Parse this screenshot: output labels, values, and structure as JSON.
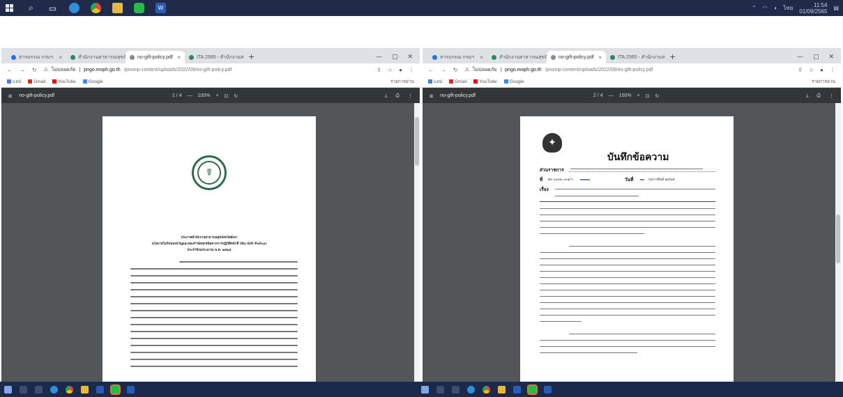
{
  "taskbar_top": {
    "icons": [
      "windows-logo-icon",
      "search-icon",
      "task-view-icon",
      "edge-icon",
      "chrome-icon",
      "file-explorer-icon",
      "line-app-icon",
      "word-icon"
    ],
    "clock_time": "11:54",
    "clock_date": "01/09/2565",
    "lang": "ไทย"
  },
  "left_window": {
    "tabs": [
      {
        "label": "สารบรรณ กรมฯ",
        "active": false
      },
      {
        "label": "สำนักงานสาธารณสุขจังหวัด",
        "active": false
      },
      {
        "label": "no-gift-policy.pdf",
        "active": true
      },
      {
        "label": "ITA 2565 - สำนักงานสาธารณสุข",
        "active": false
      }
    ],
    "url_host": "pngo.moph.go.th",
    "url_path": "/pnoinp-content/uploads/2022/09/no-gift-policy.pdf",
    "url_secure_label": "ไม่ปลอดภัย",
    "bookmarks": [
      "แอป",
      "Gmail",
      "YouTube",
      "Google"
    ],
    "bookmarks_right": "รายการอ่าน",
    "pdf_filename": "no-gift-policy.pdf",
    "pdf_page": "1 / 4",
    "pdf_zoom": "100%",
    "doc": {
      "heading": "ประกาศสำนักงานสาธารณสุขจังหวัดพังงา",
      "title": "นโยบายไม่รับของขวัญและของกำนัลทุกชนิดจากการปฏิบัติหน้าที่ (No Gift Policy)",
      "subtitle": "ประจำปีงบประมาณ พ.ศ. ๒๕๖๕"
    }
  },
  "right_window": {
    "tabs": [
      {
        "label": "สารบรรณ กรมฯ",
        "active": false
      },
      {
        "label": "สำนักงานสาธารณสุขจังหวัด",
        "active": false
      },
      {
        "label": "no-gift-policy.pdf",
        "active": true
      },
      {
        "label": "ITA 2565 - สำนักงานสาธารณสุข",
        "active": false
      }
    ],
    "url_host": "pngo.moph.go.th",
    "url_path": "/pnoinp-content/uploads/2022/09/no-gift-policy.pdf",
    "url_secure_label": "ไม่ปลอดภัย",
    "bookmarks": [
      "แอป",
      "Gmail",
      "YouTube",
      "Google"
    ],
    "bookmarks_right": "รายการอ่าน",
    "pdf_filename": "no-gift-policy.pdf",
    "pdf_page": "2 / 4",
    "pdf_zoom": "100%",
    "memo": {
      "title": "บันทึกข้อความ",
      "label_agency": "ส่วนราชการ",
      "label_number": "ที่",
      "label_date": "วันที่",
      "label_subject": "เรื่อง",
      "number_value": "พง ๐๐๓๓.๐๐๑/ว",
      "date_value": "กุมภาพันธ์ ๒๕๖๕"
    }
  },
  "colors": {
    "taskbar": "#1f2b48",
    "pdf_toolbar": "#323639",
    "viewer_bg": "#525659",
    "seal_green": "#2f6d4a"
  }
}
